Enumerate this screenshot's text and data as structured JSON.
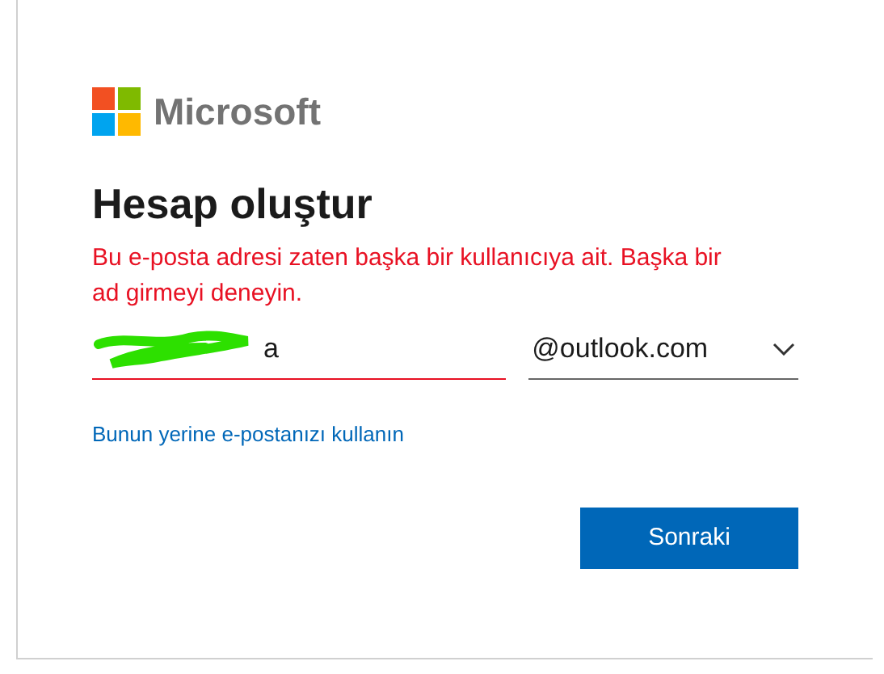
{
  "logo": {
    "text": "Microsoft"
  },
  "title": "Hesap oluştur",
  "error": "Bu e-posta adresi zaten başka bir kullanıcıya ait. Başka bir ad girmeyi deneyin.",
  "username": {
    "value": "a",
    "invalid": true
  },
  "domain": {
    "value": "@outlook.com"
  },
  "link": "Bunun yerine e-postanızı kullanın",
  "buttons": [
    "Sonraki"
  ]
}
